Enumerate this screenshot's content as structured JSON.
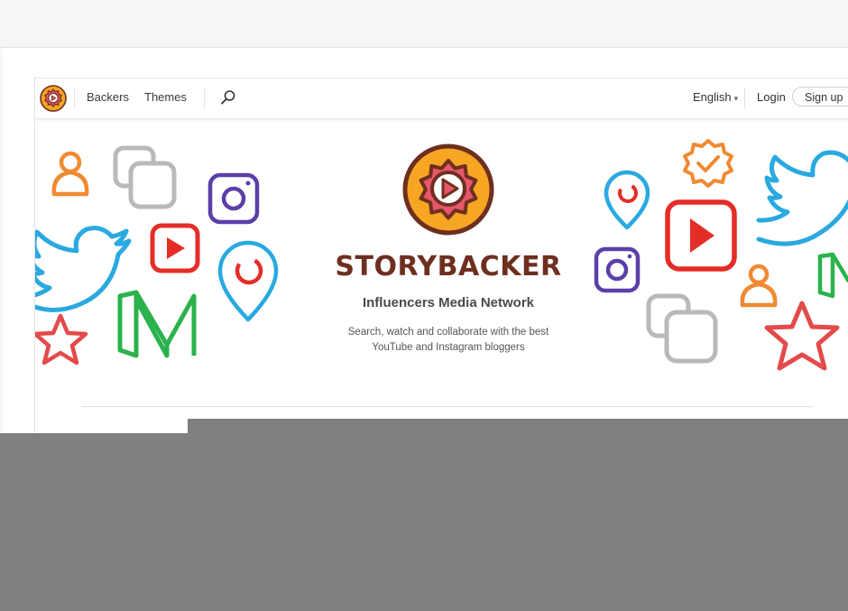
{
  "nav": {
    "items": [
      "Backers",
      "Themes"
    ],
    "language": "English",
    "login": "Login",
    "signup": "Sign up"
  },
  "hero": {
    "brand": "STORYBACKER",
    "tagline": "Influencers Media Network",
    "description_line1": "Search, watch and collaborate with the best",
    "description_line2": "YouTube and Instagram bloggers"
  },
  "icons": [
    "logo-icon",
    "search-icon",
    "chevron-down-icon",
    "person-icon",
    "copy-icon",
    "instagram-icon",
    "twitter-bird-icon",
    "youtube-play-icon",
    "periscope-pin-icon",
    "medium-icon",
    "star-icon",
    "verified-badge-icon"
  ],
  "colors": {
    "brand_brown": "#6e2f1f",
    "youtube_red": "#e52d27",
    "twitter_blue": "#2aa9e0",
    "instagram_purple": "#5b3fa8",
    "medium_green": "#2bb24c",
    "orange": "#f08a32",
    "gray": "#b9b9b9",
    "star_red": "#e34a4a"
  }
}
